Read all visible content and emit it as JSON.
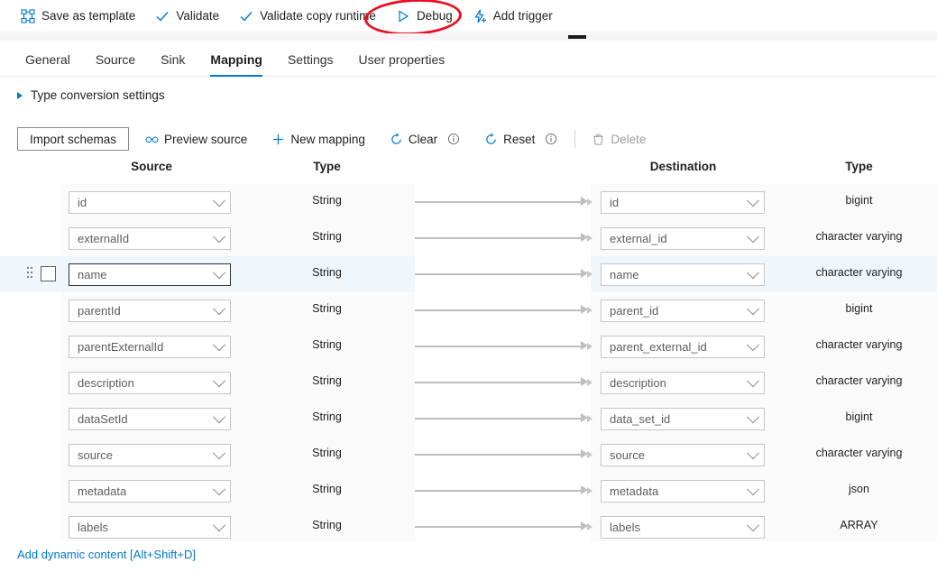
{
  "commandbar": {
    "items": [
      {
        "label": "Save as template",
        "icon": "template-icon"
      },
      {
        "label": "Validate",
        "icon": "check-icon"
      },
      {
        "label": "Validate copy runtime",
        "icon": "check-icon"
      },
      {
        "label": "Debug",
        "icon": "play-icon"
      },
      {
        "label": "Add trigger",
        "icon": "lightning-plus-icon"
      }
    ]
  },
  "annotation": {
    "target": "Debug",
    "color": "#e81123"
  },
  "tabs": {
    "items": [
      {
        "label": "General",
        "active": false
      },
      {
        "label": "Source",
        "active": false
      },
      {
        "label": "Sink",
        "active": false
      },
      {
        "label": "Mapping",
        "active": true
      },
      {
        "label": "Settings",
        "active": false
      },
      {
        "label": "User properties",
        "active": false
      }
    ],
    "accent": "#0078d4"
  },
  "type_conversion": {
    "label": "Type conversion settings",
    "expanded": false
  },
  "actions": {
    "import_schemas": "Import schemas",
    "preview_source": "Preview source",
    "new_mapping": "New mapping",
    "clear": "Clear",
    "reset": "Reset",
    "delete": "Delete",
    "delete_disabled": true
  },
  "grid": {
    "headers": {
      "source": "Source",
      "source_type": "Type",
      "destination": "Destination",
      "destination_type": "Type"
    },
    "rows": [
      {
        "source": "id",
        "source_type": "String",
        "destination": "id",
        "destination_type": "bigint",
        "selected": false
      },
      {
        "source": "externalId",
        "source_type": "String",
        "destination": "external_id",
        "destination_type": "character varying",
        "selected": false
      },
      {
        "source": "name",
        "source_type": "String",
        "destination": "name",
        "destination_type": "character varying",
        "selected": true
      },
      {
        "source": "parentId",
        "source_type": "String",
        "destination": "parent_id",
        "destination_type": "bigint",
        "selected": false
      },
      {
        "source": "parentExternalId",
        "source_type": "String",
        "destination": "parent_external_id",
        "destination_type": "character varying",
        "selected": false
      },
      {
        "source": "description",
        "source_type": "String",
        "destination": "description",
        "destination_type": "character varying",
        "selected": false
      },
      {
        "source": "dataSetId",
        "source_type": "String",
        "destination": "data_set_id",
        "destination_type": "bigint",
        "selected": false
      },
      {
        "source": "source",
        "source_type": "String",
        "destination": "source",
        "destination_type": "character varying",
        "selected": false
      },
      {
        "source": "metadata",
        "source_type": "String",
        "destination": "metadata",
        "destination_type": "json",
        "selected": false
      },
      {
        "source": "labels",
        "source_type": "String",
        "destination": "labels",
        "destination_type": "ARRAY",
        "selected": false
      }
    ]
  },
  "footer": {
    "dynamic_content_link": "Add dynamic content [Alt+Shift+D]"
  }
}
